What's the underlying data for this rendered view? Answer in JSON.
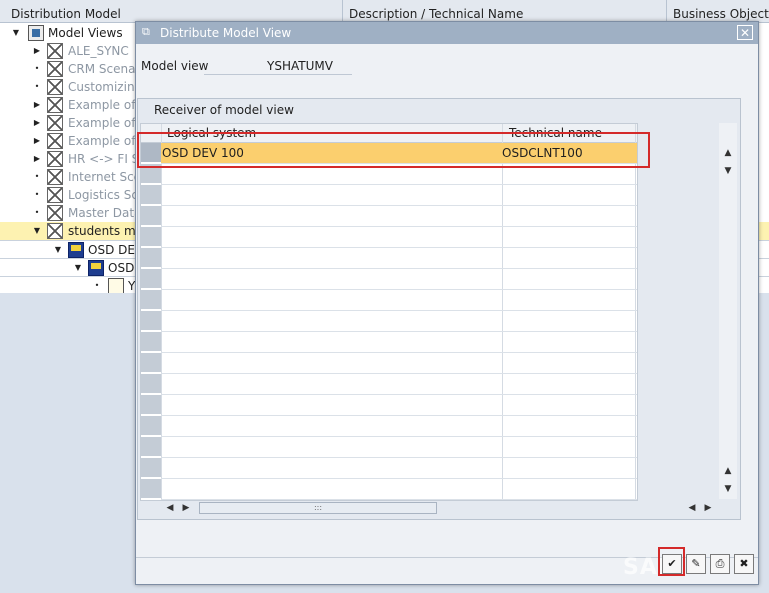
{
  "background": {
    "headers": {
      "col1": "Distribution Model",
      "col2": "Description / Technical Name",
      "col3": "Business Object"
    },
    "tree": {
      "root": "Model Views",
      "items": [
        "ALE_SYNC",
        "CRM Scenari",
        "Customizing",
        "Example of I",
        "Example of I",
        "Example of (",
        "HR <-> FI S",
        "Internet Sce",
        "Logistics Sce",
        "Master Data",
        "students mo"
      ],
      "child1": "OSD DEV",
      "child2": "OSD",
      "child3": "Y"
    }
  },
  "modal": {
    "title": "Distribute Model View",
    "model_view_label": "Model view",
    "model_view_value": "YSHATUMV",
    "group_title": "Receiver of model view",
    "columns": [
      "Logical system",
      "Technical name"
    ],
    "rows": [
      {
        "logical_system": "OSD DEV 100",
        "technical_name": "OSDCLNT100"
      }
    ],
    "scroll_grip": ":::",
    "watermark": "SAP"
  },
  "icons": {
    "close": "close-icon",
    "title": "window-icon",
    "continue": "continue-check-icon",
    "cancel": "cancel-icon"
  },
  "colors": {
    "selected_row": "#fbcf6e",
    "highlight_border": "#d42a2a",
    "title_bar": "#9fb0c4"
  }
}
